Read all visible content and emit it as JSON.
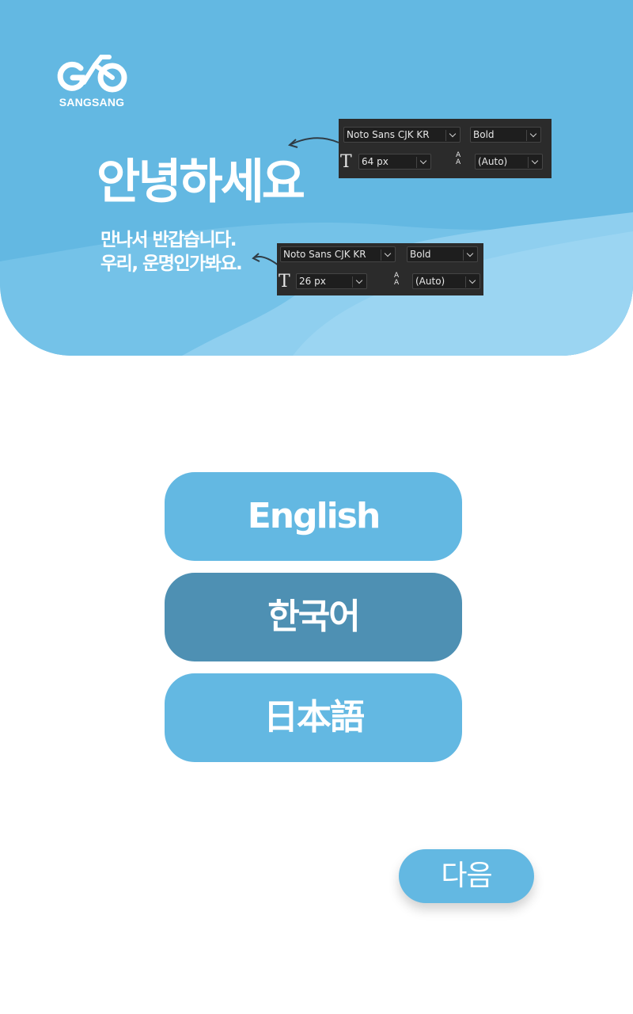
{
  "colors": {
    "primary": "#63b8e2",
    "selected": "#4e90b3",
    "panel_bg": "#2b2b2b"
  },
  "brand": {
    "logo_text": "SANGSANG",
    "logo_icon": "bicycle-icon"
  },
  "hero": {
    "greeting": "안녕하세요",
    "subtitle_line1": "만나서 반갑습니다.",
    "subtitle_line2": "우리, 운명인가봐요."
  },
  "annotations": [
    {
      "font": "Noto Sans CJK KR",
      "weight": "Bold",
      "size": "64 px",
      "leading": "(Auto)"
    },
    {
      "font": "Noto Sans CJK KR",
      "weight": "Bold",
      "size": "26 px",
      "leading": "(Auto)"
    }
  ],
  "languages": [
    {
      "label": "English",
      "selected": false
    },
    {
      "label": "한국어",
      "selected": true
    },
    {
      "label": "日本語",
      "selected": false
    }
  ],
  "next_label": "다음"
}
